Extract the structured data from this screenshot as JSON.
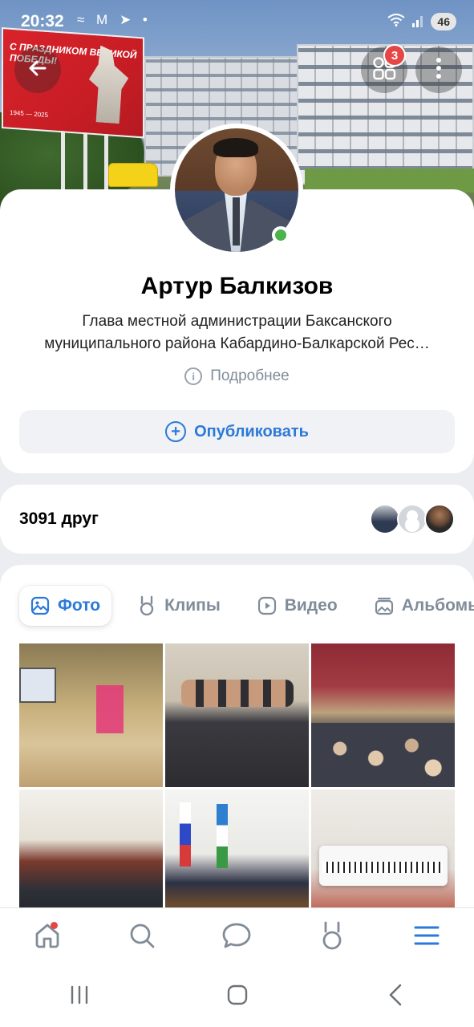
{
  "status_bar": {
    "time": "20:32",
    "left_icons": "≈ M ➤ •",
    "battery": "46"
  },
  "header": {
    "notifications_count": "3",
    "billboard_text": "С праздником Великой Победы!",
    "billboard_years": "1945 — 2025"
  },
  "profile": {
    "name": "Артур Балкизов",
    "status_line1": "Глава местной администрации Баксанского",
    "status_line2": "муниципального района Кабардино-Балкарской Рес…",
    "details_label": "Подробнее",
    "publish_label": "Опубликовать",
    "online": true
  },
  "friends": {
    "label": "3091 друг"
  },
  "media_tabs": [
    {
      "label": "Фото",
      "icon": "image-icon",
      "active": true
    },
    {
      "label": "Клипы",
      "icon": "clips-icon",
      "active": false
    },
    {
      "label": "Видео",
      "icon": "video-icon",
      "active": false
    },
    {
      "label": "Альбомы",
      "icon": "albums-icon",
      "active": false
    }
  ],
  "photos_count_shown": 6,
  "bottom_nav": [
    {
      "name": "home",
      "icon": "home-icon",
      "badge": true
    },
    {
      "name": "search",
      "icon": "search-icon"
    },
    {
      "name": "messages",
      "icon": "chat-icon"
    },
    {
      "name": "clips",
      "icon": "clips-icon"
    },
    {
      "name": "menu",
      "icon": "menu-icon",
      "active": true
    }
  ],
  "colors": {
    "accent": "#2b79d9",
    "secondary_text": "#818c99",
    "online": "#4bb34b",
    "badge": "#e64646"
  }
}
